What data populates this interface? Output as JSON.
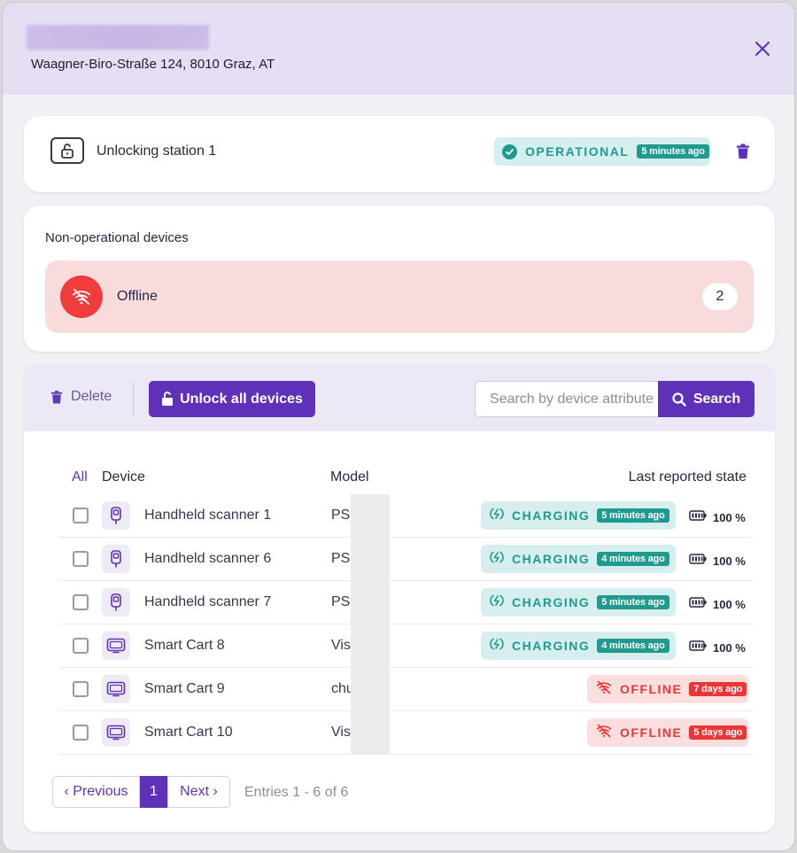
{
  "header": {
    "address": "Waagner-Biro-Straße 124, 8010 Graz, AT"
  },
  "station": {
    "name": "Unlocking station 1",
    "status": "OPERATIONAL",
    "status_time": "5 minutes ago"
  },
  "non_operational": {
    "title": "Non-operational devices",
    "items": [
      {
        "label": "Offline",
        "count": "2"
      }
    ]
  },
  "toolbar": {
    "delete_label": "Delete",
    "unlock_label": "Unlock all devices",
    "search_placeholder": "Search by device attribute",
    "search_label": "Search"
  },
  "table": {
    "headers": {
      "all": "All",
      "device": "Device",
      "model": "Model",
      "state": "Last reported state"
    },
    "rows": [
      {
        "name": "Handheld scanner 1",
        "model": "PS3",
        "type": "scanner",
        "state": "CHARGING",
        "time": "5 minutes ago",
        "battery": "100 %"
      },
      {
        "name": "Handheld scanner 6",
        "model": "PS3",
        "type": "scanner",
        "state": "CHARGING",
        "time": "4 minutes ago",
        "battery": "100 %"
      },
      {
        "name": "Handheld scanner 7",
        "model": "PS2",
        "type": "scanner",
        "state": "CHARGING",
        "time": "5 minutes ago",
        "battery": "100 %"
      },
      {
        "name": "Smart Cart 8",
        "model": "Vis",
        "type": "cart",
        "state": "CHARGING",
        "time": "4 minutes ago",
        "battery": "100 %"
      },
      {
        "name": "Smart Cart 9",
        "model": "chu",
        "type": "cart",
        "state": "OFFLINE",
        "time": "7 days ago",
        "battery": ""
      },
      {
        "name": "Smart Cart 10",
        "model": "Vis",
        "type": "cart",
        "state": "OFFLINE",
        "time": "5 days ago",
        "battery": ""
      }
    ]
  },
  "pagination": {
    "prev": "‹ Previous",
    "current": "1",
    "next": "Next ›",
    "entries": "Entries 1 - 6 of  6"
  },
  "colors": {
    "accent": "#5f31b8",
    "operational": "#1f9a8e",
    "offline": "#ec3535",
    "header_bg": "#e6def3"
  }
}
